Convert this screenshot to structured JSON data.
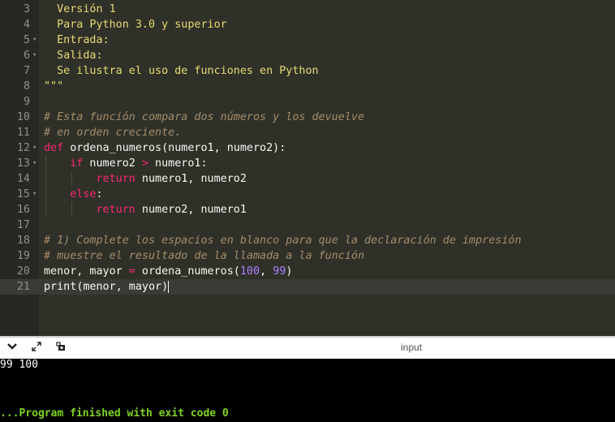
{
  "editor": {
    "lines": [
      {
        "n": "3",
        "fold": "",
        "guides": 0,
        "tokens": [
          {
            "t": "  Versión 1",
            "c": "str"
          }
        ]
      },
      {
        "n": "4",
        "fold": "",
        "guides": 0,
        "tokens": [
          {
            "t": "  Para Python 3.0 y superior",
            "c": "str"
          }
        ]
      },
      {
        "n": "5",
        "fold": "▾",
        "guides": 0,
        "tokens": [
          {
            "t": "  Entrada:",
            "c": "str"
          }
        ]
      },
      {
        "n": "6",
        "fold": "▾",
        "guides": 0,
        "tokens": [
          {
            "t": "  Salida:",
            "c": "str"
          }
        ]
      },
      {
        "n": "7",
        "fold": "",
        "guides": 0,
        "tokens": [
          {
            "t": "  Se ilustra el uso de funciones en Python",
            "c": "str"
          }
        ]
      },
      {
        "n": "8",
        "fold": "",
        "guides": 0,
        "tokens": [
          {
            "t": "\"\"\"",
            "c": "str"
          }
        ]
      },
      {
        "n": "9",
        "fold": "",
        "guides": 0,
        "tokens": []
      },
      {
        "n": "10",
        "fold": "",
        "guides": 0,
        "tokens": [
          {
            "t": "# Esta función compara dos números y los devuelve",
            "c": "cm"
          }
        ]
      },
      {
        "n": "11",
        "fold": "",
        "guides": 0,
        "tokens": [
          {
            "t": "# en orden creciente.",
            "c": "cm"
          }
        ]
      },
      {
        "n": "12",
        "fold": "▾",
        "guides": 0,
        "tokens": [
          {
            "t": "def",
            "c": "kw"
          },
          {
            "t": " ordena_numeros(numero1, numero2):",
            "c": "fn"
          }
        ]
      },
      {
        "n": "13",
        "fold": "▾",
        "guides": 1,
        "tokens": [
          {
            "t": "    ",
            "c": "fn"
          },
          {
            "t": "if",
            "c": "kw"
          },
          {
            "t": " numero2 ",
            "c": "fn"
          },
          {
            "t": ">",
            "c": "kw"
          },
          {
            "t": " numero1:",
            "c": "fn"
          }
        ]
      },
      {
        "n": "14",
        "fold": "",
        "guides": 2,
        "tokens": [
          {
            "t": "        ",
            "c": "fn"
          },
          {
            "t": "return",
            "c": "kw"
          },
          {
            "t": " numero1, numero2",
            "c": "fn"
          }
        ]
      },
      {
        "n": "15",
        "fold": "▾",
        "guides": 1,
        "tokens": [
          {
            "t": "    ",
            "c": "fn"
          },
          {
            "t": "else",
            "c": "kw"
          },
          {
            "t": ":",
            "c": "fn"
          }
        ]
      },
      {
        "n": "16",
        "fold": "",
        "guides": 2,
        "tokens": [
          {
            "t": "        ",
            "c": "fn"
          },
          {
            "t": "return",
            "c": "kw"
          },
          {
            "t": " numero2, numero1",
            "c": "fn"
          }
        ]
      },
      {
        "n": "17",
        "fold": "",
        "guides": 0,
        "tokens": []
      },
      {
        "n": "18",
        "fold": "",
        "guides": 0,
        "tokens": [
          {
            "t": "# 1) Complete los espacios en blanco para que la declaración de impresión",
            "c": "cm"
          }
        ]
      },
      {
        "n": "19",
        "fold": "",
        "guides": 0,
        "tokens": [
          {
            "t": "# muestre el resultado de la llamada a la función",
            "c": "cm"
          }
        ]
      },
      {
        "n": "20",
        "fold": "",
        "guides": 0,
        "tokens": [
          {
            "t": "menor, mayor ",
            "c": "fn"
          },
          {
            "t": "=",
            "c": "kw"
          },
          {
            "t": " ordena_numeros(",
            "c": "fn"
          },
          {
            "t": "100",
            "c": "num"
          },
          {
            "t": ", ",
            "c": "fn"
          },
          {
            "t": "99",
            "c": "num"
          },
          {
            "t": ")",
            "c": "fn"
          }
        ]
      },
      {
        "n": "21",
        "fold": "",
        "guides": 0,
        "active": true,
        "tokens": [
          {
            "t": "print",
            "c": "fn"
          },
          {
            "t": "(menor, mayor)",
            "c": "fn"
          }
        ]
      }
    ]
  },
  "terminal": {
    "title": "input",
    "icons": [
      "chevron-down-icon",
      "expand-icon",
      "screenshot-icon"
    ],
    "output": "99 100",
    "status": "...Program finished with exit code 0"
  },
  "colors": {
    "string": "#e6db74",
    "keyword": "#f92672",
    "comment": "#a58c6a",
    "number": "#ae81ff",
    "status": "#7ed321"
  }
}
